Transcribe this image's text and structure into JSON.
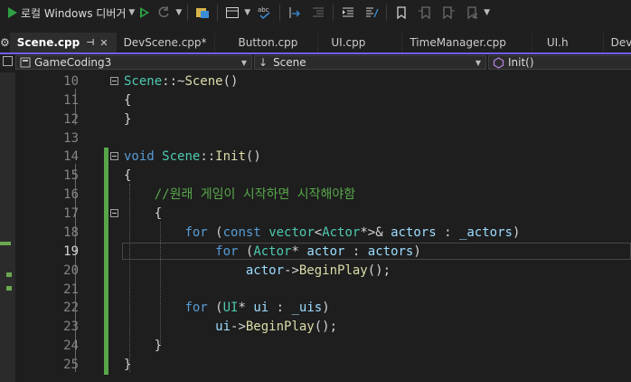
{
  "toolbar": {
    "debugger_label": "로컬 Windows 디버거",
    "icons": [
      "start-debug-icon",
      "start-without-debug-icon",
      "refresh-icon",
      "solution-explorer-icon",
      "window-layout-icon",
      "spell-check-icon",
      "step-icon",
      "indent-icon",
      "comment-icon",
      "uncomment-icon",
      "bookmark-icon",
      "prev-bookmark-icon",
      "next-bookmark-icon",
      "clear-bookmarks-icon"
    ]
  },
  "tabs": [
    {
      "label": "Scene.cpp",
      "active": true
    },
    {
      "label": "DevScene.cpp*"
    },
    {
      "label": "Button.cpp"
    },
    {
      "label": "UI.cpp"
    },
    {
      "label": "TimeManager.cpp"
    },
    {
      "label": "UI.h"
    },
    {
      "label": "DevSce"
    }
  ],
  "nav": {
    "project": "GameCoding3",
    "scope": "Scene",
    "member": "Init()"
  },
  "code": {
    "current_line": 19,
    "lines": [
      {
        "n": "10",
        "tokens": [
          [
            "cls",
            "Scene"
          ],
          [
            "pun",
            "::~"
          ],
          [
            "fn",
            "Scene"
          ],
          [
            "pun",
            "()"
          ]
        ]
      },
      {
        "n": "11",
        "tokens": [
          [
            "pun",
            "{"
          ]
        ]
      },
      {
        "n": "12",
        "tokens": [
          [
            "pun",
            "}"
          ]
        ]
      },
      {
        "n": "13",
        "tokens": []
      },
      {
        "n": "14",
        "tokens": [
          [
            "kw",
            "void"
          ],
          [
            "pun",
            " "
          ],
          [
            "cls",
            "Scene"
          ],
          [
            "pun",
            "::"
          ],
          [
            "fn",
            "Init"
          ],
          [
            "pun",
            "()"
          ]
        ]
      },
      {
        "n": "15",
        "tokens": [
          [
            "pun",
            "{"
          ]
        ]
      },
      {
        "n": "16",
        "tokens": [
          [
            "pun",
            "    "
          ],
          [
            "cmt",
            "//원래 게임이 시작하면 시작해야함"
          ]
        ]
      },
      {
        "n": "17",
        "tokens": [
          [
            "pun",
            "    {"
          ]
        ]
      },
      {
        "n": "18",
        "tokens": [
          [
            "pun",
            "        "
          ],
          [
            "kw",
            "for"
          ],
          [
            "pun",
            " ("
          ],
          [
            "kw",
            "const"
          ],
          [
            "pun",
            " "
          ],
          [
            "cls",
            "vector"
          ],
          [
            "pun",
            "<"
          ],
          [
            "cls",
            "Actor"
          ],
          [
            "pun",
            "*>& "
          ],
          [
            "var",
            "actors"
          ],
          [
            "pun",
            " : "
          ],
          [
            "var",
            "_actors"
          ],
          [
            "pun",
            ")"
          ]
        ]
      },
      {
        "n": "19",
        "tokens": [
          [
            "pun",
            "            "
          ],
          [
            "kw",
            "for"
          ],
          [
            "pun",
            " ("
          ],
          [
            "cls",
            "Actor"
          ],
          [
            "pun",
            "* "
          ],
          [
            "var",
            "actor"
          ],
          [
            "pun",
            " : "
          ],
          [
            "var",
            "actors"
          ],
          [
            "pun",
            ")"
          ]
        ]
      },
      {
        "n": "20",
        "tokens": [
          [
            "pun",
            "                "
          ],
          [
            "var",
            "actor"
          ],
          [
            "pun",
            "->"
          ],
          [
            "fn",
            "BeginPlay"
          ],
          [
            "pun",
            "();"
          ]
        ]
      },
      {
        "n": "21",
        "tokens": []
      },
      {
        "n": "22",
        "tokens": [
          [
            "pun",
            "        "
          ],
          [
            "kw",
            "for"
          ],
          [
            "pun",
            " ("
          ],
          [
            "cls",
            "UI"
          ],
          [
            "pun",
            "* "
          ],
          [
            "var",
            "ui"
          ],
          [
            "pun",
            " : "
          ],
          [
            "var",
            "_uis"
          ],
          [
            "pun",
            ")"
          ]
        ]
      },
      {
        "n": "23",
        "tokens": [
          [
            "pun",
            "            "
          ],
          [
            "var",
            "ui"
          ],
          [
            "pun",
            "->"
          ],
          [
            "fn",
            "BeginPlay"
          ],
          [
            "pun",
            "();"
          ]
        ]
      },
      {
        "n": "24",
        "tokens": [
          [
            "pun",
            "    }"
          ]
        ]
      },
      {
        "n": "25",
        "tokens": [
          [
            "pun",
            "}"
          ]
        ]
      }
    ]
  },
  "colors": {
    "accent": "#7160e8",
    "change_bar": "#57a64a",
    "keyword": "#569cd6",
    "type": "#4ec9b0",
    "function": "#dcdcaa",
    "variable": "#9cdcfe",
    "comment": "#57a64a"
  }
}
